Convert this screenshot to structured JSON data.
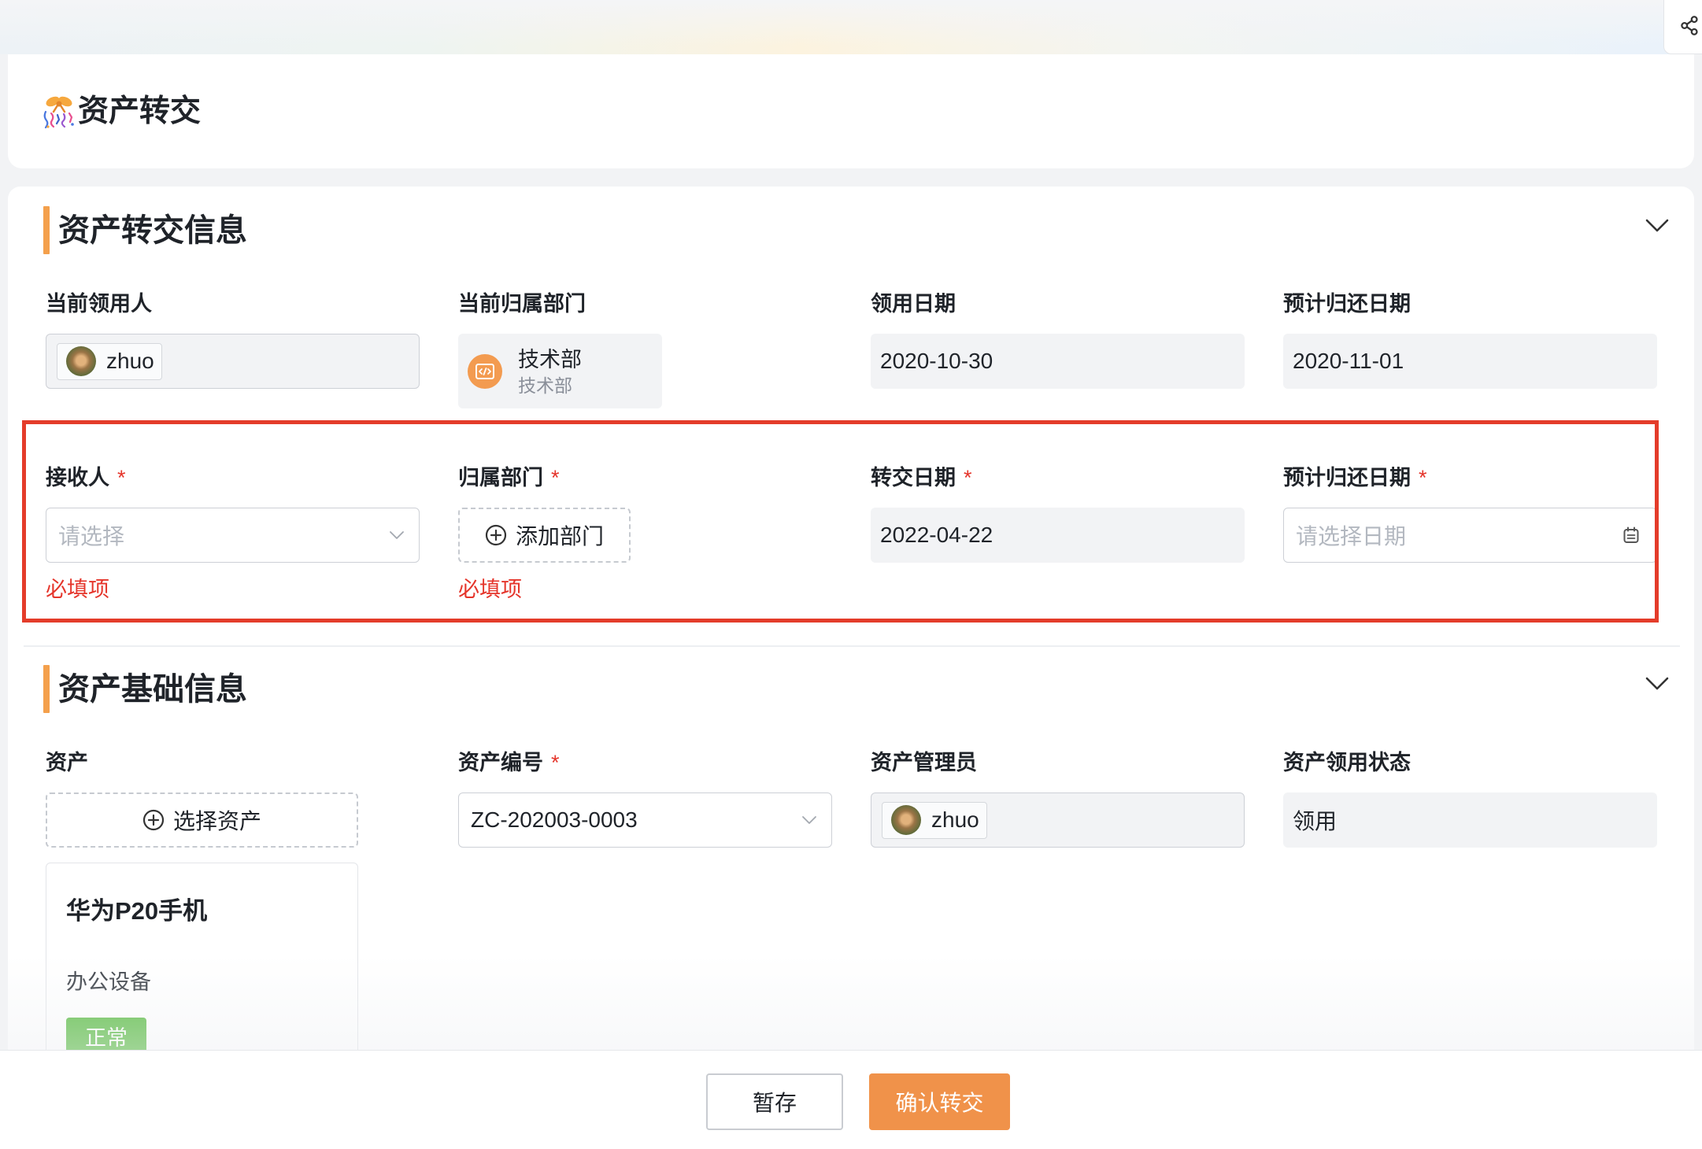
{
  "colors": {
    "accent_orange": "#f0924a",
    "section_bar": "#f4a04c",
    "required_red": "#e5352b",
    "highlight_red": "#e43c2a",
    "status_green": "#5cbd45",
    "field_gray": "#f2f3f5"
  },
  "share_button": {
    "icon": "share-icon"
  },
  "header": {
    "icon": "gift-icon",
    "title": "资产转交"
  },
  "transfer_info": {
    "title": "资产转交信息",
    "collapse_icon": "chevron-down-icon",
    "current_user": {
      "label": "当前领用人",
      "name": "zhuo"
    },
    "current_department": {
      "label": "当前归属部门",
      "name": "技术部",
      "path": "技术部",
      "icon": "department-icon"
    },
    "receive_date": {
      "label": "领用日期",
      "value": "2020-10-30"
    },
    "expected_return_date": {
      "label": "预计归还日期",
      "value": "2020-11-01"
    },
    "receiver": {
      "label": "接收人",
      "required_mark": "*",
      "placeholder": "请选择",
      "error": "必填项"
    },
    "department": {
      "label": "归属部门",
      "required_mark": "*",
      "button_label": "添加部门",
      "error": "必填项"
    },
    "transfer_date": {
      "label": "转交日期",
      "required_mark": "*",
      "value": "2022-04-22"
    },
    "new_return_date": {
      "label": "预计归还日期",
      "required_mark": "*",
      "placeholder": "请选择日期",
      "icon": "calendar-icon"
    }
  },
  "basic_info": {
    "title": "资产基础信息",
    "collapse_icon": "chevron-down-icon",
    "asset": {
      "label": "资产",
      "button_label": "选择资产",
      "card": {
        "name": "华为P20手机",
        "category": "办公设备",
        "status": "正常"
      }
    },
    "asset_code": {
      "label": "资产编号",
      "required_mark": "*",
      "value": "ZC-202003-0003"
    },
    "asset_admin": {
      "label": "资产管理员",
      "name": "zhuo"
    },
    "use_status": {
      "label": "资产领用状态",
      "value": "领用"
    }
  },
  "footer": {
    "save_label": "暂存",
    "confirm_label": "确认转交"
  }
}
